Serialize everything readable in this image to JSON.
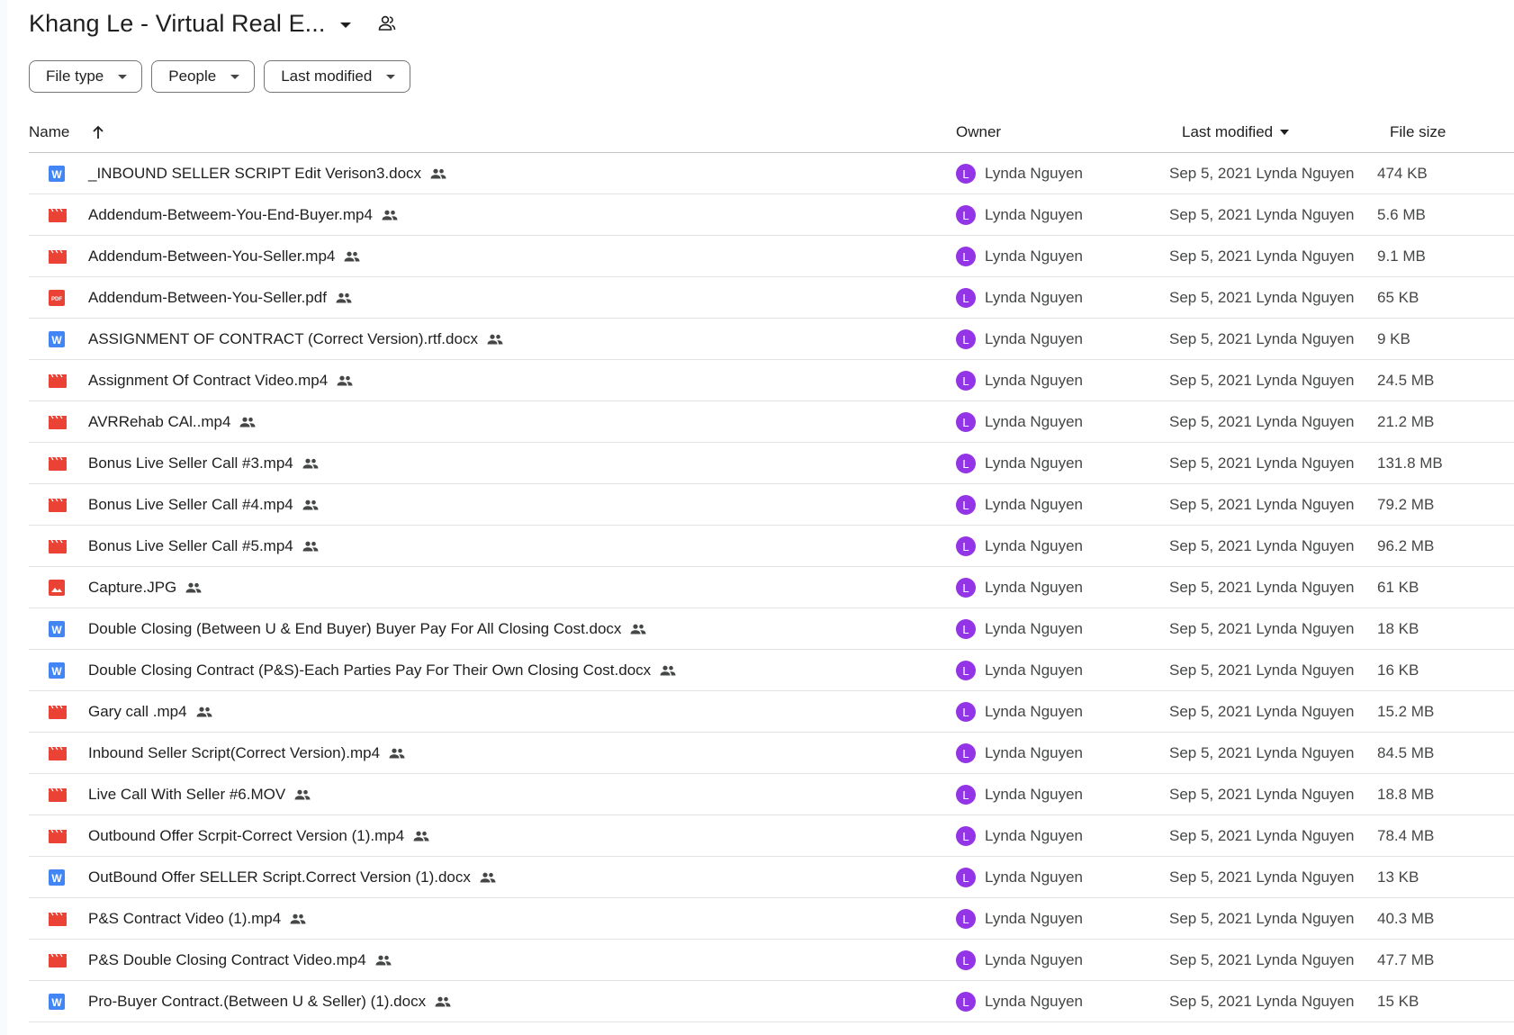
{
  "header": {
    "title": "Khang Le - Virtual Real E..."
  },
  "filters": {
    "file_type": "File type",
    "people": "People",
    "last_modified": "Last modified"
  },
  "columns": {
    "name": "Name",
    "owner": "Owner",
    "last_modified": "Last modified",
    "file_size": "File size"
  },
  "colors": {
    "avatar": "#9334e6",
    "word": "#4285f4",
    "video": "#ea4335",
    "pdf": "#ea4335",
    "image": "#ea4335"
  },
  "files": [
    {
      "name": "_INBOUND SELLER SCRIPT Edit Verison3.docx",
      "type": "word",
      "owner": "Lynda Nguyen",
      "avatar": "L",
      "modified": "Sep 5, 2021 Lynda Nguyen",
      "size": "474 KB"
    },
    {
      "name": "Addendum-Betweem-You-End-Buyer.mp4",
      "type": "video",
      "owner": "Lynda Nguyen",
      "avatar": "L",
      "modified": "Sep 5, 2021 Lynda Nguyen",
      "size": "5.6 MB"
    },
    {
      "name": "Addendum-Between-You-Seller.mp4",
      "type": "video",
      "owner": "Lynda Nguyen",
      "avatar": "L",
      "modified": "Sep 5, 2021 Lynda Nguyen",
      "size": "9.1 MB"
    },
    {
      "name": "Addendum-Between-You-Seller.pdf",
      "type": "pdf",
      "owner": "Lynda Nguyen",
      "avatar": "L",
      "modified": "Sep 5, 2021 Lynda Nguyen",
      "size": "65 KB"
    },
    {
      "name": "ASSIGNMENT OF CONTRACT (Correct Version).rtf.docx",
      "type": "word",
      "owner": "Lynda Nguyen",
      "avatar": "L",
      "modified": "Sep 5, 2021 Lynda Nguyen",
      "size": "9 KB"
    },
    {
      "name": "Assignment Of Contract Video.mp4",
      "type": "video",
      "owner": "Lynda Nguyen",
      "avatar": "L",
      "modified": "Sep 5, 2021 Lynda Nguyen",
      "size": "24.5 MB"
    },
    {
      "name": "AVRRehab CAl..mp4",
      "type": "video",
      "owner": "Lynda Nguyen",
      "avatar": "L",
      "modified": "Sep 5, 2021 Lynda Nguyen",
      "size": "21.2 MB"
    },
    {
      "name": "Bonus Live Seller Call #3.mp4",
      "type": "video",
      "owner": "Lynda Nguyen",
      "avatar": "L",
      "modified": "Sep 5, 2021 Lynda Nguyen",
      "size": "131.8 MB"
    },
    {
      "name": "Bonus Live Seller Call #4.mp4",
      "type": "video",
      "owner": "Lynda Nguyen",
      "avatar": "L",
      "modified": "Sep 5, 2021 Lynda Nguyen",
      "size": "79.2 MB"
    },
    {
      "name": "Bonus Live Seller Call #5.mp4",
      "type": "video",
      "owner": "Lynda Nguyen",
      "avatar": "L",
      "modified": "Sep 5, 2021 Lynda Nguyen",
      "size": "96.2 MB"
    },
    {
      "name": "Capture.JPG",
      "type": "image",
      "owner": "Lynda Nguyen",
      "avatar": "L",
      "modified": "Sep 5, 2021 Lynda Nguyen",
      "size": "61 KB"
    },
    {
      "name": "Double Closing (Between U & End Buyer) Buyer Pay For All Closing Cost.docx",
      "type": "word",
      "owner": "Lynda Nguyen",
      "avatar": "L",
      "modified": "Sep 5, 2021 Lynda Nguyen",
      "size": "18 KB"
    },
    {
      "name": "Double Closing Contract (P&S)-Each Parties Pay For Their Own Closing Cost.docx",
      "type": "word",
      "owner": "Lynda Nguyen",
      "avatar": "L",
      "modified": "Sep 5, 2021 Lynda Nguyen",
      "size": "16 KB"
    },
    {
      "name": "Gary call .mp4",
      "type": "video",
      "owner": "Lynda Nguyen",
      "avatar": "L",
      "modified": "Sep 5, 2021 Lynda Nguyen",
      "size": "15.2 MB"
    },
    {
      "name": "Inbound Seller Script(Correct Version).mp4",
      "type": "video",
      "owner": "Lynda Nguyen",
      "avatar": "L",
      "modified": "Sep 5, 2021 Lynda Nguyen",
      "size": "84.5 MB"
    },
    {
      "name": "Live Call With Seller #6.MOV",
      "type": "video",
      "owner": "Lynda Nguyen",
      "avatar": "L",
      "modified": "Sep 5, 2021 Lynda Nguyen",
      "size": "18.8 MB"
    },
    {
      "name": "Outbound Offer Scrpit-Correct Version (1).mp4",
      "type": "video",
      "owner": "Lynda Nguyen",
      "avatar": "L",
      "modified": "Sep 5, 2021 Lynda Nguyen",
      "size": "78.4 MB"
    },
    {
      "name": "OutBound Offer SELLER Script.Correct Version (1).docx",
      "type": "word",
      "owner": "Lynda Nguyen",
      "avatar": "L",
      "modified": "Sep 5, 2021 Lynda Nguyen",
      "size": "13 KB"
    },
    {
      "name": "P&S Contract Video (1).mp4",
      "type": "video",
      "owner": "Lynda Nguyen",
      "avatar": "L",
      "modified": "Sep 5, 2021 Lynda Nguyen",
      "size": "40.3 MB"
    },
    {
      "name": "P&S Double Closing Contract Video.mp4",
      "type": "video",
      "owner": "Lynda Nguyen",
      "avatar": "L",
      "modified": "Sep 5, 2021 Lynda Nguyen",
      "size": "47.7 MB"
    },
    {
      "name": "Pro-Buyer Contract.(Between U & Seller) (1).docx",
      "type": "word",
      "owner": "Lynda Nguyen",
      "avatar": "L",
      "modified": "Sep 5, 2021 Lynda Nguyen",
      "size": "15 KB"
    }
  ]
}
